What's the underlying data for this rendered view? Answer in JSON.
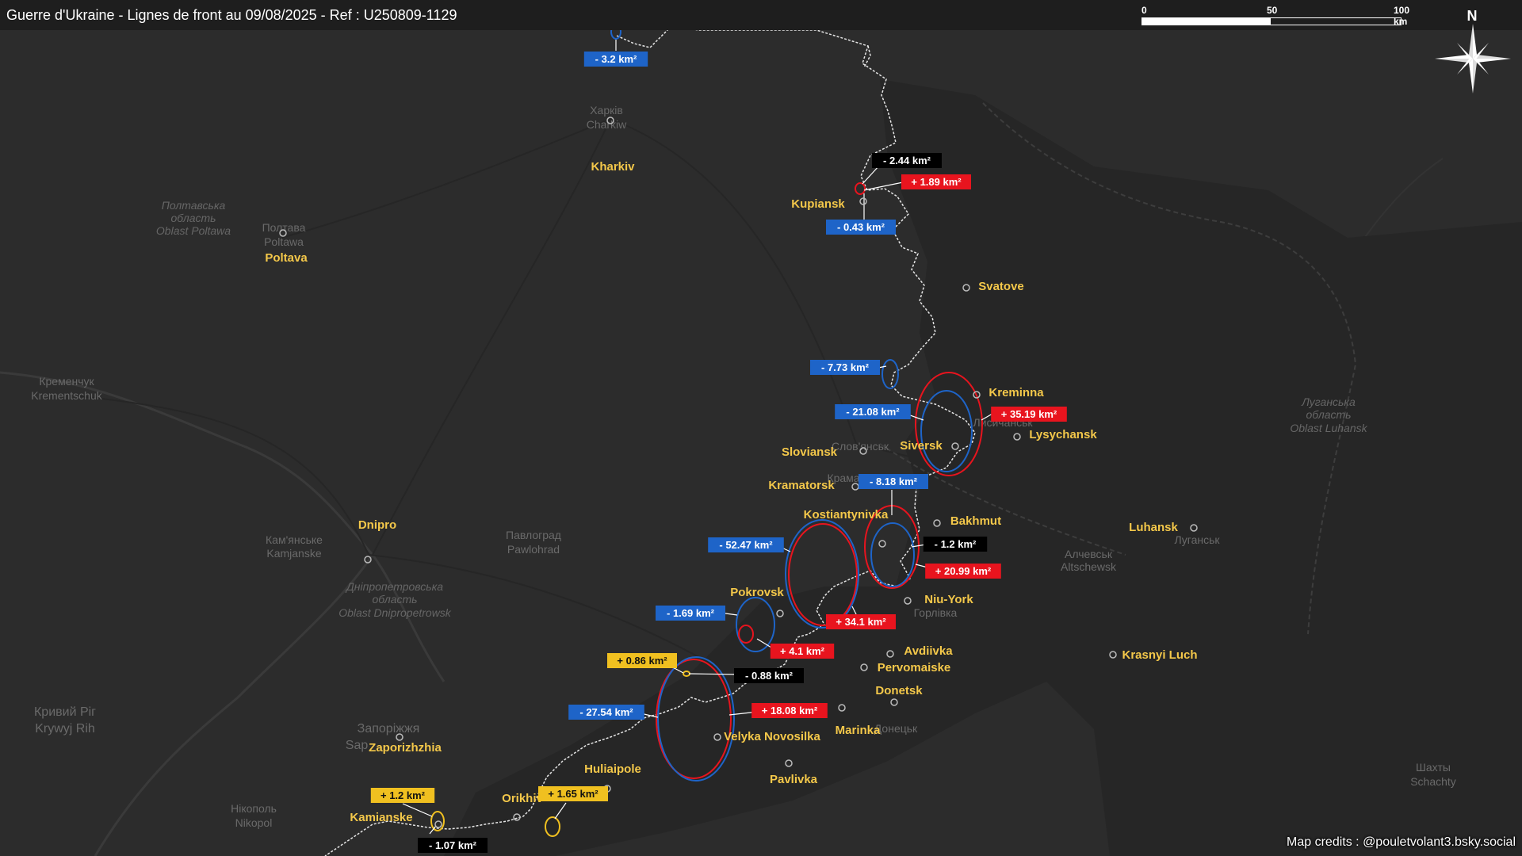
{
  "title": "Guerre d'Ukraine - Lignes de front au 09/08/2025 - Ref : U250809-1129",
  "scale": {
    "ticks": [
      "0",
      "50",
      "100 km"
    ]
  },
  "compass": {
    "north_label": "N"
  },
  "credits": "Map credits : @pouletvolant3.bsky.social",
  "colors": {
    "gain": "#e8141e",
    "loss": "#1e64c8",
    "neutral": "#000000",
    "disputed": "#f0c020",
    "city_label": "#f4c84a",
    "frontline": "#ffffff"
  },
  "cities": [
    {
      "name": "Kharkiv"
    },
    {
      "name": "Kupiansk"
    },
    {
      "name": "Svatove"
    },
    {
      "name": "Poltava"
    },
    {
      "name": "Kreminna"
    },
    {
      "name": "Lysychansk"
    },
    {
      "name": "Siversk"
    },
    {
      "name": "Sloviansk"
    },
    {
      "name": "Kramatorsk"
    },
    {
      "name": "Kostiantynivka"
    },
    {
      "name": "Bakhmut"
    },
    {
      "name": "Dnipro"
    },
    {
      "name": "Luhansk"
    },
    {
      "name": "Pokrovsk"
    },
    {
      "name": "Niu-York"
    },
    {
      "name": "Avdiivka"
    },
    {
      "name": "Pervomaiske"
    },
    {
      "name": "Krasnyi Luch"
    },
    {
      "name": "Donetsk"
    },
    {
      "name": "Marinka"
    },
    {
      "name": "Velyka Novosilka"
    },
    {
      "name": "Zaporizhzhia"
    },
    {
      "name": "Huliaipole"
    },
    {
      "name": "Pavlivka"
    },
    {
      "name": "Orikhiv"
    },
    {
      "name": "Kamianske"
    }
  ],
  "background_labels": [
    "Харків",
    "Charkiw",
    "Полтавська",
    "область",
    "Oblast Poltawa",
    "Полтава",
    "Poltawa",
    "Кременчук",
    "Krementschuk",
    "Дніпропетровська",
    "область",
    "Oblast Dnipropetrowsk",
    "Кам'янське",
    "Kamjanske",
    "Павлоград",
    "Pawlohrad",
    "Кривий Ріг",
    "Krywyj Rih",
    "Запоріжжя",
    "Sap",
    "Нікополь",
    "Nikopol",
    "Луганська",
    "область",
    "Oblast Luhansk",
    "Лисичанськ",
    "Слов'янськ",
    "Краматорськ",
    "Горлівка",
    "Луганськ",
    "Алчевськ",
    "Altschewsk",
    "Донецьк",
    "Шахты",
    "Schachty"
  ],
  "changes": [
    {
      "label": "- 3.2 km²",
      "type": "loss"
    },
    {
      "label": "- 2.44 km²",
      "type": "neutral"
    },
    {
      "label": "+ 1.89 km²",
      "type": "gain"
    },
    {
      "label": "- 0.43 km²",
      "type": "loss"
    },
    {
      "label": "- 7.73 km²",
      "type": "loss"
    },
    {
      "label": "- 21.08 km²",
      "type": "loss"
    },
    {
      "label": "+ 35.19 km²",
      "type": "gain"
    },
    {
      "label": "- 8.18 km²",
      "type": "loss"
    },
    {
      "label": "- 1.2 km²",
      "type": "neutral"
    },
    {
      "label": "+ 20.99 km²",
      "type": "gain"
    },
    {
      "label": "- 52.47 km²",
      "type": "loss"
    },
    {
      "label": "+ 34.1 km²",
      "type": "gain"
    },
    {
      "label": "- 1.69 km²",
      "type": "loss"
    },
    {
      "label": "+ 4.1 km²",
      "type": "gain"
    },
    {
      "label": "+ 0.86 km²",
      "type": "disputed"
    },
    {
      "label": "- 0.88 km²",
      "type": "neutral"
    },
    {
      "label": "- 27.54 km²",
      "type": "loss"
    },
    {
      "label": "+ 18.08 km²",
      "type": "gain"
    },
    {
      "label": "+ 1.2 km²",
      "type": "disputed"
    },
    {
      "label": "- 1.07 km²",
      "type": "neutral"
    },
    {
      "label": "+ 1.65 km²",
      "type": "disputed"
    }
  ]
}
